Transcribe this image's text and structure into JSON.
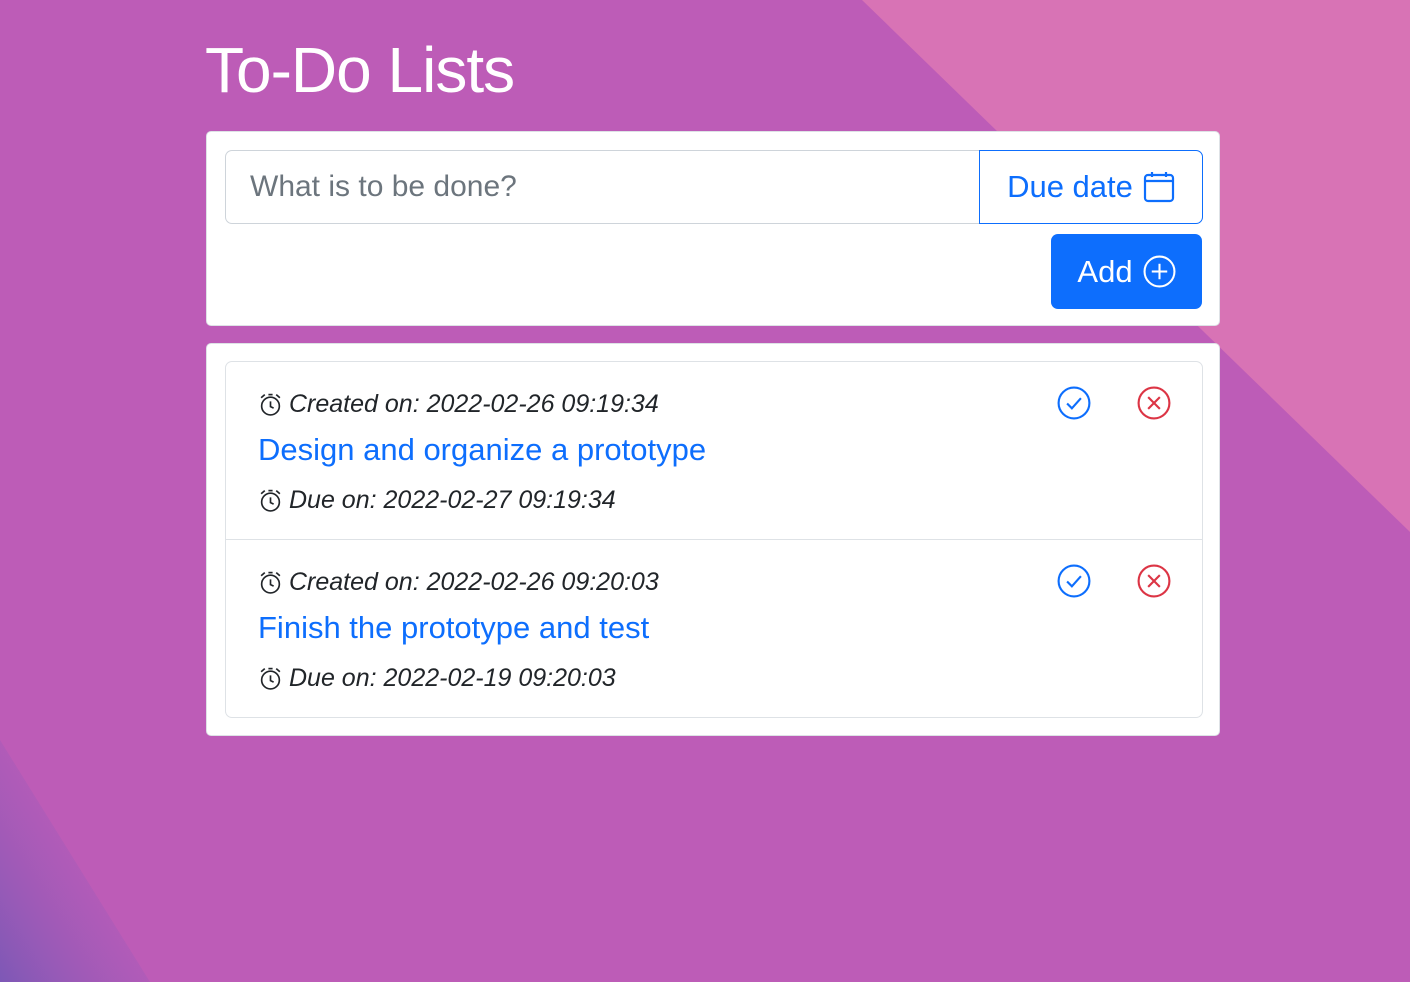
{
  "app": {
    "title": "To-Do Lists"
  },
  "form": {
    "placeholder": "What is to be done?",
    "value": "",
    "due_label": "Due date",
    "add_label": "Add"
  },
  "todos": [
    {
      "created_text": "Created on: 2022-02-26 09:19:34",
      "title": "Design and organize a prototype",
      "due_text": "Due on: 2022-02-27 09:19:34"
    },
    {
      "created_text": "Created on: 2022-02-26 09:20:03",
      "title": "Finish the prototype and test",
      "due_text": "Due on: 2022-02-19 09:20:03"
    }
  ],
  "icons": {
    "due": "calendar-icon",
    "add": "plus-circle-icon",
    "created": "alarm-icon",
    "due_on": "alarm-icon",
    "done": "check-circle-icon",
    "delete": "x-circle-icon"
  },
  "colors": {
    "background": "#bd5cb7",
    "background_accent": "#d873b5",
    "primary": "#0d6efd",
    "danger": "#dc3545",
    "text": "#212529",
    "placeholder": "#6c757d"
  }
}
